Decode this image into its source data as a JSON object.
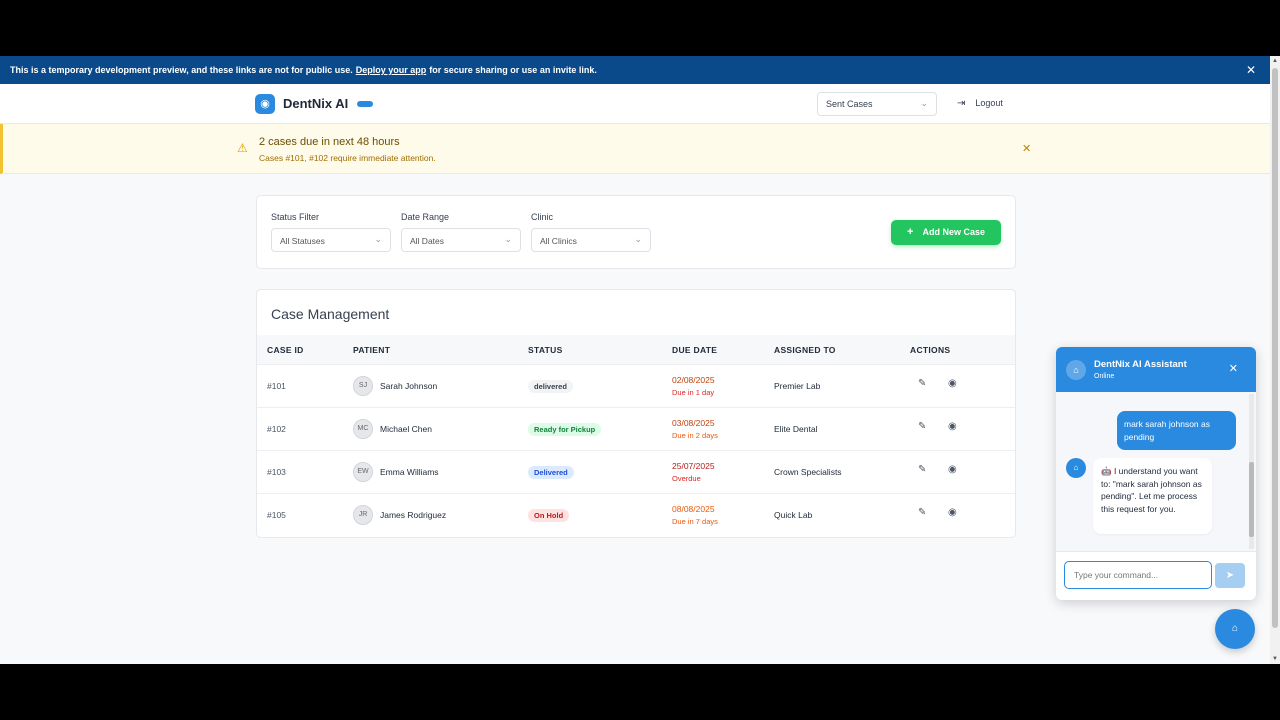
{
  "devbar": {
    "text_before": "This is a temporary development preview, and these links are not for public use.",
    "link": "Deploy your app",
    "text_after": "for secure sharing or use an invite link."
  },
  "header": {
    "brand": "DentNix AI",
    "view_select": "Sent Cases",
    "logout": "Logout"
  },
  "alert": {
    "title": "2 cases due in next 48 hours",
    "message": "Cases #101, #102 require immediate attention."
  },
  "filters": {
    "status": {
      "label": "Status Filter",
      "value": "All Statuses"
    },
    "date": {
      "label": "Date Range",
      "value": "All Dates"
    },
    "clinic": {
      "label": "Clinic",
      "value": "All Clinics"
    },
    "add_button": "Add New Case"
  },
  "cases": {
    "heading": "Case Management",
    "columns": [
      "CASE ID",
      "PATIENT",
      "STATUS",
      "DUE DATE",
      "ASSIGNED TO",
      "ACTIONS"
    ],
    "rows": [
      {
        "id": "#101",
        "initials": "SJ",
        "patient": "Sarah Johnson",
        "status": "delivered",
        "due": "02/08/2025",
        "due_sub": "Due in 1 day",
        "assigned": "Premier Lab"
      },
      {
        "id": "#102",
        "initials": "MC",
        "patient": "Michael Chen",
        "status": "Ready for Pickup",
        "due": "03/08/2025",
        "due_sub": "Due in 2 days",
        "assigned": "Elite Dental"
      },
      {
        "id": "#103",
        "initials": "EW",
        "patient": "Emma Williams",
        "status": "Delivered",
        "due": "25/07/2025",
        "due_sub": "Overdue",
        "assigned": "Crown Specialists"
      },
      {
        "id": "#105",
        "initials": "JR",
        "patient": "James Rodriguez",
        "status": "On Hold",
        "due": "08/08/2025",
        "due_sub": "Due in 7 days",
        "assigned": "Quick Lab"
      }
    ]
  },
  "chat": {
    "title": "DentNix AI Assistant",
    "status": "Online",
    "user_message": "mark sarah johnson as pending",
    "bot_message": "🤖 I understand you want to: \"mark sarah johnson as pending\". Let me process this request for you.",
    "input_placeholder": "Type your command..."
  },
  "colors": {
    "primary": "#2a8ae0",
    "success": "#22c55e",
    "devbar": "#0a4a8a",
    "alert_bg": "#fffbea"
  }
}
